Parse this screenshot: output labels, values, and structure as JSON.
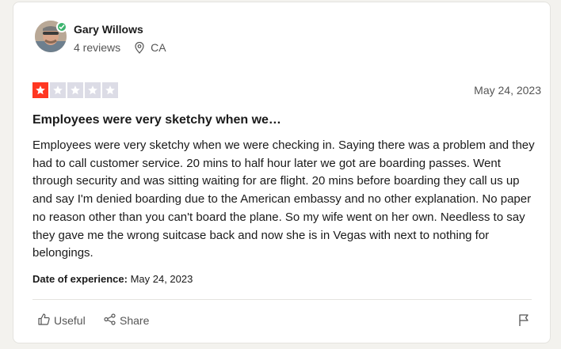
{
  "reviewer": {
    "name": "Gary Willows",
    "reviews": "4 reviews",
    "country": "CA"
  },
  "review": {
    "rating": 1,
    "max_rating": 5,
    "date": "May 24, 2023",
    "title": "Employees were very sketchy when we…",
    "body": "Employees were very sketchy when we were checking in. Saying there was a problem and they had to call customer service. 20 mins to half hour later we got are boarding passes. Went through security and was sitting waiting for are flight. 20 mins before boarding they call us up and say I'm denied boarding due to the American embassy and no other explanation. No paper no reason other than you can't board the plane. So my wife went on her own. Needless to say they gave me the wrong suitcase back and now she is in Vegas with next to nothing for belongings.",
    "experience_label": "Date of experience:",
    "experience_date": "May 24, 2023"
  },
  "actions": {
    "useful": "Useful",
    "share": "Share"
  },
  "colors": {
    "star_active": "#ff3722",
    "star_inactive": "#dcdce6",
    "verified": "#3cb46e"
  },
  "icons": [
    "verified-check-icon",
    "location-pin-icon",
    "thumbs-up-icon",
    "share-icon",
    "flag-icon"
  ]
}
